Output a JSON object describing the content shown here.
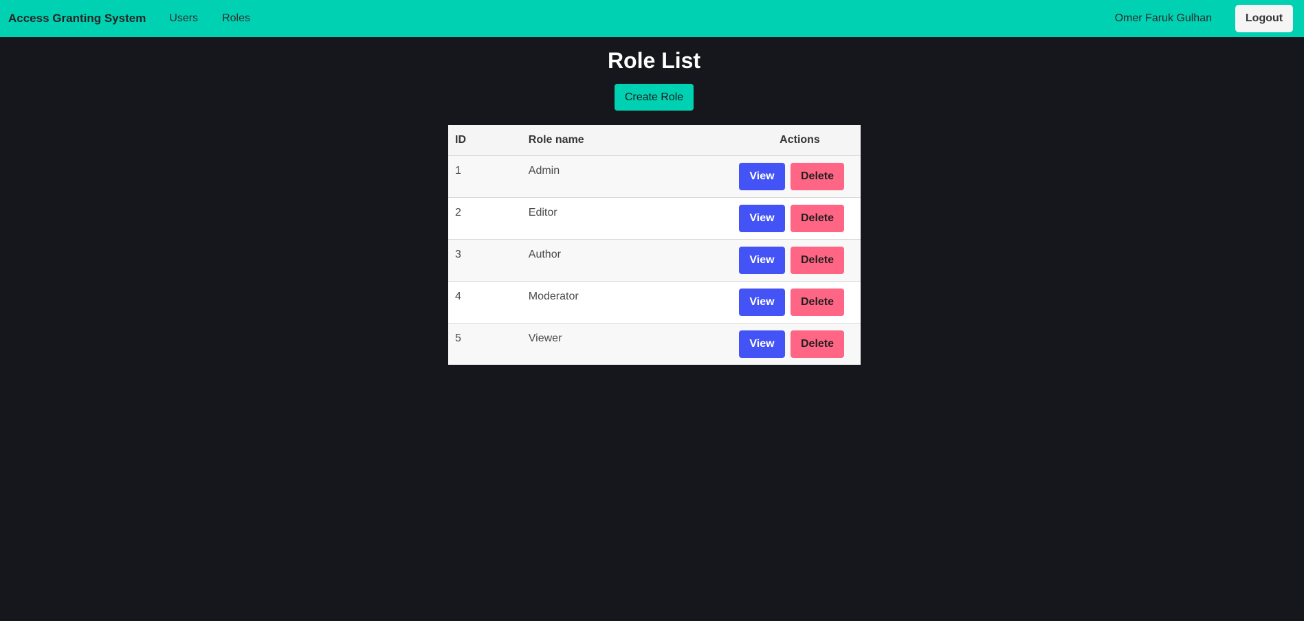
{
  "navbar": {
    "brand": "Access Granting System",
    "links": [
      "Users",
      "Roles"
    ],
    "user_name": "Omer Faruk Gulhan",
    "logout_label": "Logout"
  },
  "page": {
    "title": "Role List",
    "create_label": "Create Role"
  },
  "table": {
    "headers": {
      "id": "ID",
      "role_name": "Role name",
      "actions": "Actions"
    },
    "rows": [
      {
        "id": "1",
        "name": "Admin",
        "view": "View",
        "delete": "Delete"
      },
      {
        "id": "2",
        "name": "Editor",
        "view": "View",
        "delete": "Delete"
      },
      {
        "id": "3",
        "name": "Author",
        "view": "View",
        "delete": "Delete"
      },
      {
        "id": "4",
        "name": "Moderator",
        "view": "View",
        "delete": "Delete"
      },
      {
        "id": "5",
        "name": "Viewer",
        "view": "View",
        "delete": "Delete"
      }
    ]
  },
  "colors": {
    "navbar": "#00d1b2",
    "background": "#16171c",
    "view_button": "#4353f5",
    "delete_button": "#ff6685"
  }
}
